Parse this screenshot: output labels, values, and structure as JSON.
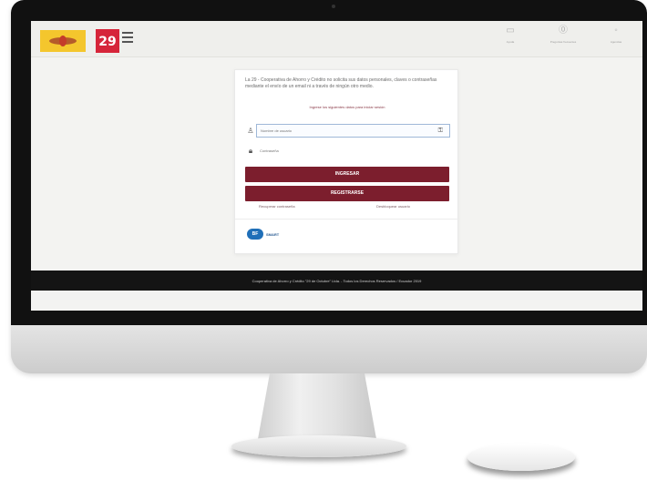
{
  "header": {
    "logo_29_text": "29",
    "links": [
      {
        "icon": "user-icon",
        "label": "Ayuda"
      },
      {
        "icon": "info-icon",
        "label": "Preguntas frecuentes"
      },
      {
        "icon": "location-icon",
        "label": "Agencias"
      }
    ]
  },
  "login": {
    "intro": "La 29 - Cooperativa de Ahorro y Crédito no solicita sus datos personales, claves o contraseñas mediante el envío de un email ni a través de ningún otro medio.",
    "subtitle": "Ingrese los siguientes datos para iniciar sesión",
    "username_placeholder": "Nombre de usuario",
    "password_placeholder": "Contraseña",
    "login_label": "INGRESAR",
    "register_label": "REGISTRARSE",
    "recover_link": "Recuperar contraseña",
    "unlock_link": "Desbloquear usuario",
    "brand_badge": "BF",
    "brand_name": "SMART"
  },
  "footer": {
    "text": "Cooperativa de Ahorro y Crédito \"29 de Octubre\" Ltda. - Todos los Derechos Reservados / Ecuador 2019"
  },
  "colors": {
    "primary": "#7c1e2d",
    "footer_bg": "#141414",
    "logo_yellow": "#f4c62d",
    "logo_red": "#d6253a"
  }
}
